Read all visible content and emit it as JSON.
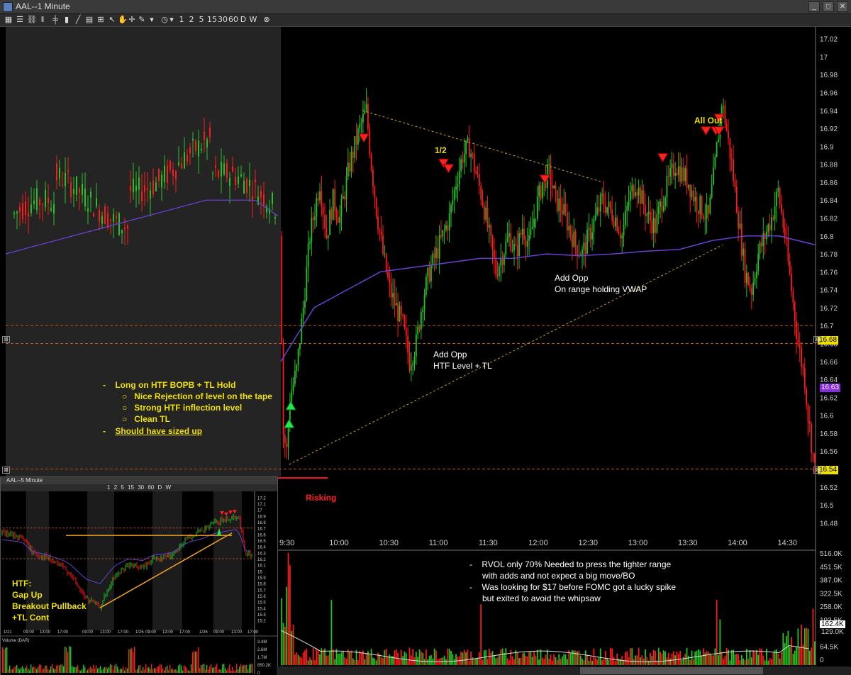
{
  "window": {
    "title": "AAL--1 Minute"
  },
  "toolbar": {
    "timeframes": [
      "1",
      "2",
      "5",
      "15",
      "30",
      "60",
      "D",
      "W"
    ]
  },
  "inset": {
    "title": "AAL--5 Minute",
    "timeframes": [
      "1",
      "2",
      "5",
      "15",
      "30",
      "60",
      "D",
      "W"
    ],
    "x_labels": [
      "1/21",
      "09:00",
      "13:00",
      "17:00",
      "09:00",
      "13:00",
      "17:00",
      "1/25",
      "09:00",
      "13:00",
      "17:00",
      "1/26",
      "09:00",
      "13:00",
      "17:00"
    ],
    "y_labels": [
      "17.2",
      "17.1",
      "17",
      "16.9",
      "16.8",
      "16.7",
      "16.6",
      "16.5",
      "16.4",
      "16.3",
      "16.2",
      "16.1",
      "16",
      "15.9",
      "15.8",
      "15.7",
      "15.6",
      "15.5",
      "15.4",
      "15.3",
      "15.2"
    ],
    "volume_label": "Volume (DAR)",
    "volume_ticks": [
      "3.4M",
      "2.6M",
      "1.7M",
      "850.2K",
      "0"
    ],
    "notes": [
      "HTF:",
      "Gap Up",
      "Breakout Pullback",
      "+TL Cont"
    ]
  },
  "chart_data": {
    "type": "candlestick",
    "symbol": "AAL",
    "interval": "1 Minute",
    "x_ticks": [
      "9:30",
      "10:00",
      "10:30",
      "11:00",
      "11:30",
      "12:00",
      "12:30",
      "13:00",
      "13:30",
      "14:00",
      "14:30"
    ],
    "y_ticks": [
      "17.02",
      "17",
      "16.98",
      "16.96",
      "16.94",
      "16.92",
      "16.9",
      "16.88",
      "16.86",
      "16.84",
      "16.82",
      "16.8",
      "16.78",
      "16.76",
      "16.74",
      "16.72",
      "16.7",
      "16.68",
      "16.66",
      "16.64",
      "16.62",
      "16.6",
      "16.58",
      "16.56",
      "16.54",
      "16.52",
      "16.5",
      "16.48"
    ],
    "ylim": [
      16.47,
      17.03
    ],
    "price_markers": [
      {
        "value": "16.68",
        "bg": "#f0e000",
        "fg": "#000"
      },
      {
        "value": "16.63",
        "bg": "#8a2be2",
        "fg": "#fff"
      },
      {
        "value": "16.54",
        "bg": "#f0e000",
        "fg": "#000"
      }
    ],
    "volume_ticks": [
      "516.0K",
      "451.5K",
      "387.0K",
      "322.5K",
      "258.0K",
      "193.5K",
      "129.0K",
      "64.5K",
      "0"
    ],
    "volume_markers": [
      {
        "value": "162.4K",
        "bg": "#ffffff",
        "fg": "#000"
      },
      {
        "value": "129.0K",
        "bg": "#000000",
        "fg": "#ccc"
      }
    ],
    "levels": [
      16.7,
      16.68,
      16.54
    ],
    "price_path": [
      [
        0,
        16.8
      ],
      [
        2,
        16.58
      ],
      [
        4,
        16.56
      ],
      [
        6,
        16.62
      ],
      [
        10,
        16.65
      ],
      [
        14,
        16.72
      ],
      [
        18,
        16.8
      ],
      [
        24,
        16.86
      ],
      [
        28,
        16.8
      ],
      [
        32,
        16.84
      ],
      [
        36,
        16.82
      ],
      [
        42,
        16.88
      ],
      [
        48,
        16.92
      ],
      [
        52,
        16.94
      ],
      [
        55,
        16.88
      ],
      [
        58,
        16.83
      ],
      [
        62,
        16.78
      ],
      [
        66,
        16.74
      ],
      [
        70,
        16.72
      ],
      [
        74,
        16.7
      ],
      [
        78,
        16.66
      ],
      [
        82,
        16.68
      ],
      [
        86,
        16.73
      ],
      [
        90,
        16.76
      ],
      [
        94,
        16.78
      ],
      [
        98,
        16.8
      ],
      [
        102,
        16.82
      ],
      [
        106,
        16.86
      ],
      [
        110,
        16.89
      ],
      [
        114,
        16.9
      ],
      [
        118,
        16.87
      ],
      [
        122,
        16.84
      ],
      [
        126,
        16.8
      ],
      [
        130,
        16.76
      ],
      [
        134,
        16.78
      ],
      [
        138,
        16.8
      ],
      [
        142,
        16.78
      ],
      [
        146,
        16.81
      ],
      [
        150,
        16.79
      ],
      [
        154,
        16.83
      ],
      [
        158,
        16.86
      ],
      [
        162,
        16.87
      ],
      [
        166,
        16.84
      ],
      [
        170,
        16.83
      ],
      [
        174,
        16.81
      ],
      [
        178,
        16.79
      ],
      [
        182,
        16.78
      ],
      [
        186,
        16.8
      ],
      [
        190,
        16.82
      ],
      [
        194,
        16.84
      ],
      [
        198,
        16.83
      ],
      [
        202,
        16.82
      ],
      [
        206,
        16.8
      ],
      [
        210,
        16.84
      ],
      [
        214,
        16.86
      ],
      [
        218,
        16.84
      ],
      [
        222,
        16.82
      ],
      [
        226,
        16.81
      ],
      [
        230,
        16.84
      ],
      [
        234,
        16.86
      ],
      [
        238,
        16.88
      ],
      [
        242,
        16.87
      ],
      [
        246,
        16.86
      ],
      [
        250,
        16.84
      ],
      [
        254,
        16.83
      ],
      [
        258,
        16.82
      ],
      [
        262,
        16.88
      ],
      [
        266,
        16.95
      ],
      [
        268,
        16.93
      ],
      [
        272,
        16.88
      ],
      [
        276,
        16.82
      ],
      [
        280,
        16.76
      ],
      [
        284,
        16.74
      ],
      [
        288,
        16.78
      ],
      [
        292,
        16.8
      ],
      [
        296,
        16.82
      ],
      [
        300,
        16.85
      ],
      [
        304,
        16.8
      ],
      [
        308,
        16.74
      ],
      [
        312,
        16.68
      ],
      [
        316,
        16.64
      ],
      [
        318,
        16.6
      ],
      [
        322,
        16.54
      ]
    ],
    "vwap_path": [
      [
        0,
        16.66
      ],
      [
        20,
        16.72
      ],
      [
        40,
        16.74
      ],
      [
        60,
        16.76
      ],
      [
        80,
        16.765
      ],
      [
        100,
        16.77
      ],
      [
        120,
        16.775
      ],
      [
        140,
        16.775
      ],
      [
        160,
        16.78
      ],
      [
        180,
        16.778
      ],
      [
        200,
        16.78
      ],
      [
        220,
        16.783
      ],
      [
        240,
        16.785
      ],
      [
        260,
        16.795
      ],
      [
        280,
        16.8
      ],
      [
        300,
        16.8
      ],
      [
        322,
        16.79
      ]
    ],
    "trendlines": [
      {
        "from": [
          5,
          16.545
        ],
        "to": [
          266,
          16.79
        ]
      },
      {
        "from": [
          49,
          16.94
        ],
        "to": [
          194,
          16.86
        ]
      }
    ],
    "buy_markers": [
      [
        5,
        16.59
      ],
      [
        6,
        16.61
      ]
    ],
    "sell_markers": [
      [
        50,
        16.91
      ],
      [
        98,
        16.882
      ],
      [
        101,
        16.876
      ],
      [
        159,
        16.864
      ],
      [
        230,
        16.888
      ],
      [
        256,
        16.918
      ],
      [
        262,
        16.918
      ],
      [
        264,
        16.932
      ],
      [
        264,
        16.918
      ]
    ],
    "annotations": [
      {
        "text": "1/2",
        "color": "yellow"
      },
      {
        "text": "All Out",
        "color": "yellow"
      },
      {
        "text": "Add Opp",
        "color": "white"
      },
      {
        "text": "On range holding VWAP",
        "color": "white"
      },
      {
        "text": "Add Opp",
        "color": "white"
      },
      {
        "text": "HTF Level + TL",
        "color": "white"
      },
      {
        "text": "Risking",
        "color": "red"
      }
    ],
    "volume_spikes": [
      [
        4,
        516
      ],
      [
        5,
        460
      ],
      [
        30,
        300
      ],
      [
        120,
        280
      ],
      [
        262,
        300
      ],
      [
        264,
        210
      ],
      [
        320,
        260
      ]
    ]
  },
  "notes_box": {
    "bullet1": "Long on HTF BOPB + TL Hold",
    "sub1": "Nice Rejection of level on the tape",
    "sub2": "Strong HTF inflection level",
    "sub3": "Clean TL",
    "bullet2": "Should have sized up"
  },
  "volume_notes": {
    "line1": "RVOL only 70% Needed to press the tighter range",
    "line2": "with adds and not expect a big move/BO",
    "line3": "Was looking for $17 before FOMC got a lucky spike",
    "line4": "but exited to avoid the whipsaw"
  },
  "colors": {
    "up": "#22c422",
    "down": "#ff1a1a",
    "vwap": "#6a3fd1",
    "premarket_bg": "#242424",
    "yellow": "#f0e000"
  }
}
